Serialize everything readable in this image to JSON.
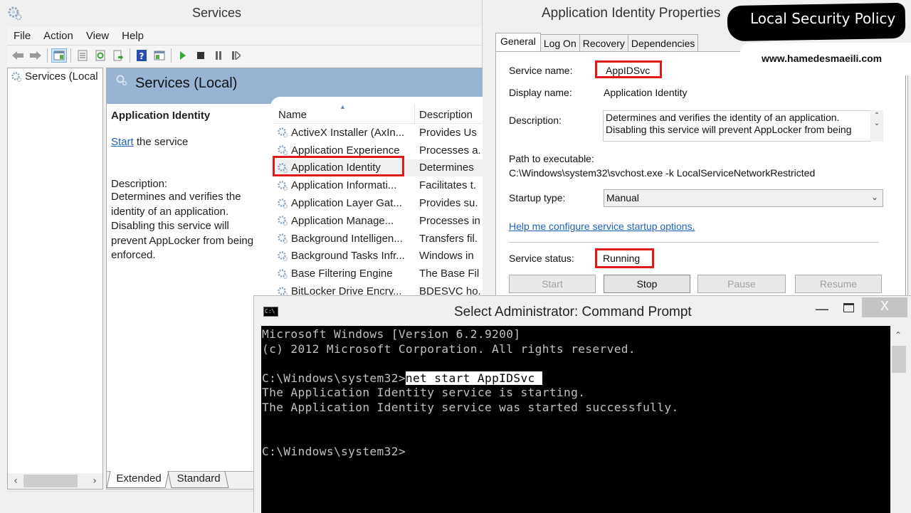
{
  "services_window": {
    "title": "Services",
    "menu": [
      "File",
      "Action",
      "View",
      "Help"
    ],
    "toolbar_icons": [
      "back-icon",
      "forward-icon",
      "show-hide-console-tree-icon",
      "properties-icon",
      "refresh-icon",
      "export-list-icon",
      "help-icon",
      "show-action-pane-icon",
      "start-service-icon",
      "stop-service-icon",
      "pause-service-icon",
      "restart-service-icon"
    ],
    "tree": {
      "item": "Services (Local"
    },
    "header_title": "Services (Local)",
    "detail": {
      "service_name": "Application Identity",
      "start_link": "Start",
      "start_suffix": " the service",
      "description_label": "Description:",
      "description_text": "Determines and verifies the identity of an application. Disabling this service will prevent AppLocker from being enforced."
    },
    "list": {
      "columns": [
        "Name",
        "Description"
      ],
      "rows": [
        {
          "name": "ActiveX Installer (AxIn...",
          "description": "Provides Us"
        },
        {
          "name": "Application Experience",
          "description": "Processes a."
        },
        {
          "name": "Application Identity",
          "description": "Determines",
          "selected": true
        },
        {
          "name": "Application Informati...",
          "description": "Facilitates t."
        },
        {
          "name": "Application Layer Gat...",
          "description": "Provides su."
        },
        {
          "name": "Application Manage...",
          "description": "Processes in"
        },
        {
          "name": "Background Intelligen...",
          "description": "Transfers fil."
        },
        {
          "name": "Background Tasks Infr...",
          "description": "Windows in"
        },
        {
          "name": "Base Filtering Engine",
          "description": "The Base Fil"
        },
        {
          "name": "BitLocker Drive Encry...",
          "description": "BDESVC ho."
        }
      ]
    },
    "view_tabs": [
      "Extended",
      "Standard"
    ]
  },
  "properties_dialog": {
    "title": "Application Identity Properties",
    "tabs": [
      "General",
      "Log On",
      "Recovery",
      "Dependencies"
    ],
    "service_name_label": "Service name:",
    "service_name": "AppIDSvc",
    "display_name_label": "Display name:",
    "display_name": "Application Identity",
    "description_label": "Description:",
    "description": "Determines and verifies the identity of an application. Disabling this service will prevent AppLocker from being",
    "path_label": "Path to executable:",
    "path": "C:\\Windows\\system32\\svchost.exe -k LocalServiceNetworkRestricted",
    "startup_type_label": "Startup type:",
    "startup_type": "Manual",
    "help_link": "Help me configure service startup options.",
    "status_label": "Service status:",
    "status": "Running",
    "buttons": {
      "start": "Start",
      "stop": "Stop",
      "pause": "Pause",
      "resume": "Resume"
    }
  },
  "overlay": {
    "banner": "Local Security Policy",
    "website": "www.hamedesmaeili.com"
  },
  "cmd_window": {
    "title": "Select Administrator: Command Prompt",
    "close_glyph": "X",
    "lines": {
      "l1": "Microsoft Windows [Version 6.2.9200]",
      "l2": "(c) 2012 Microsoft Corporation. All rights reserved.",
      "l3": "",
      "l4_prompt": "C:\\Windows\\system32>",
      "l4_command": "net start AppIDSvc ",
      "l5": "The Application Identity service is starting.",
      "l6": "The Application Identity service was started successfully.",
      "l7": "",
      "l8": "",
      "l9": "C:\\Windows\\system32>"
    }
  },
  "colors": {
    "highlight_red": "#e01a1a",
    "header_blue": "#98b4d2",
    "link_blue": "#1e62b7"
  }
}
